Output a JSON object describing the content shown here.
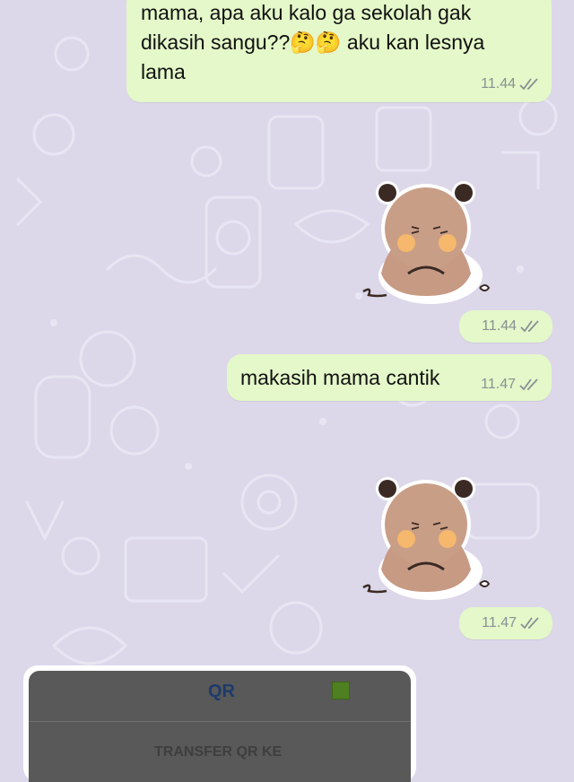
{
  "colors": {
    "wallpaper": "#dcd8ea",
    "outgoing_bubble": "#e4f8c9",
    "timestamp": "#8a8f94",
    "sheet_title": "#1e3a6a",
    "sheet_green": "#4e7f20"
  },
  "messages": [
    {
      "type": "text",
      "text": "mama, apa aku kalo ga sekolah gak\ndikasih sangu??🤔🤔 aku kan lesnya\nlama",
      "time": "11.44",
      "status": "read-double-check-icon"
    },
    {
      "type": "sticker",
      "sticker": "bear-hugging-sticker",
      "time": "11.44",
      "status": "read-double-check-icon"
    },
    {
      "type": "text",
      "text": "makasih mama cantik",
      "time": "11.47",
      "status": "read-double-check-icon"
    },
    {
      "type": "sticker",
      "sticker": "bear-hugging-sticker",
      "time": "11.47",
      "status": "read-double-check-icon"
    }
  ],
  "bottom_sheet": {
    "title": "QR",
    "label": "TRANSFER QR KE"
  }
}
